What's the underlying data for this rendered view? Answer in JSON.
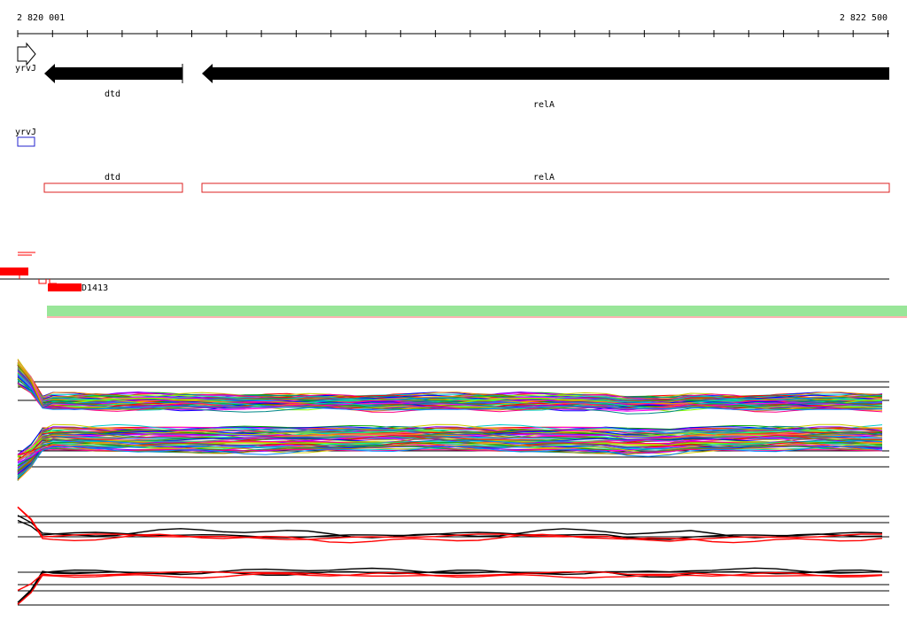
{
  "ruler": {
    "start_label": "2 820 001",
    "end_label": "2 822 500"
  },
  "genes": [
    {
      "name": "yrvJ",
      "strand": "+"
    },
    {
      "name": "dtd",
      "strand": "-"
    },
    {
      "name": "relA",
      "strand": "-"
    }
  ],
  "annotation_track": {
    "labels": [
      "yrvJ",
      "dtd",
      "relA"
    ]
  },
  "feature_label": "D1413",
  "colors": {
    "gene_arrow": "#000000",
    "box_blue": "#2222cc",
    "box_red": "#dd2222",
    "feature_red": "#ff0000",
    "green_lines": "#33cc33"
  }
}
